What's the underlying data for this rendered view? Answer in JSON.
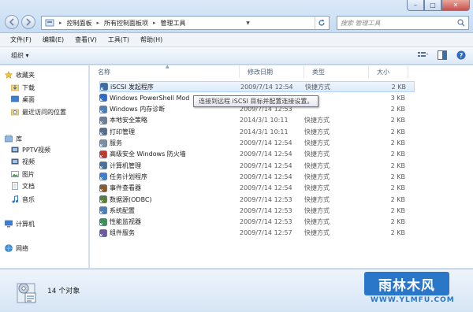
{
  "window": {
    "controls": {
      "minimize": "–",
      "maximize": "□",
      "close": "✕"
    }
  },
  "address": {
    "crumbs": [
      "控制面板",
      "所有控制面板项",
      "管理工具"
    ],
    "separator": "▸"
  },
  "search": {
    "placeholder": "搜索 管理工具"
  },
  "menu": [
    "文件(F)",
    "编辑(E)",
    "查看(V)",
    "工具(T)",
    "帮助(H)"
  ],
  "toolbar": {
    "organize": "组织 ▾"
  },
  "nav": {
    "favorites": "收藏夹",
    "favorites_items": [
      "下载",
      "桌面",
      "最近访问的位置"
    ],
    "libraries": "库",
    "library_items": [
      "PPTV视频",
      "视频",
      "图片",
      "文档",
      "音乐"
    ],
    "computer": "计算机",
    "network": "网络"
  },
  "columns": {
    "name": "名称",
    "date": "修改日期",
    "type": "类型",
    "size": "大小"
  },
  "files": [
    {
      "name": "iSCSI 发起程序",
      "date": "2009/7/14 12:54",
      "type": "快捷方式",
      "size": "2 KB"
    },
    {
      "name": "Windows PowerShell Mod",
      "date": "",
      "type": "",
      "size": "3 KB"
    },
    {
      "name": "Windows 内存诊断",
      "date": "2009/7/14 12:53",
      "type": "",
      "size": "2 KB"
    },
    {
      "name": "本地安全策略",
      "date": "2014/3/1 10:11",
      "type": "快捷方式",
      "size": "2 KB"
    },
    {
      "name": "打印管理",
      "date": "2014/3/1 10:11",
      "type": "快捷方式",
      "size": "2 KB"
    },
    {
      "name": "服务",
      "date": "2009/7/14 12:54",
      "type": "快捷方式",
      "size": "2 KB"
    },
    {
      "name": "高级安全 Windows 防火墙",
      "date": "2009/7/14 12:54",
      "type": "快捷方式",
      "size": "2 KB"
    },
    {
      "name": "计算机管理",
      "date": "2009/7/14 12:54",
      "type": "快捷方式",
      "size": "2 KB"
    },
    {
      "name": "任务计划程序",
      "date": "2009/7/14 12:54",
      "type": "快捷方式",
      "size": "2 KB"
    },
    {
      "name": "事件查看器",
      "date": "2009/7/14 12:54",
      "type": "快捷方式",
      "size": "2 KB"
    },
    {
      "name": "数据源(ODBC)",
      "date": "2009/7/14 12:53",
      "type": "快捷方式",
      "size": "2 KB"
    },
    {
      "name": "系统配置",
      "date": "2009/7/14 12:53",
      "type": "快捷方式",
      "size": "2 KB"
    },
    {
      "name": "性能监视器",
      "date": "2009/7/14 12:53",
      "type": "快捷方式",
      "size": "2 KB"
    },
    {
      "name": "组件服务",
      "date": "2009/7/14 12:57",
      "type": "快捷方式",
      "size": "2 KB"
    }
  ],
  "tooltip": "连接到远程 iSCSI 目标并配置连接设置。",
  "status": {
    "count": "14 个对象"
  },
  "watermark": {
    "logo": "雨林木风",
    "url": "WWW.YLMFU.COM"
  },
  "colors": {
    "accent": "#2a77c9",
    "selection": "#dcebfc"
  }
}
